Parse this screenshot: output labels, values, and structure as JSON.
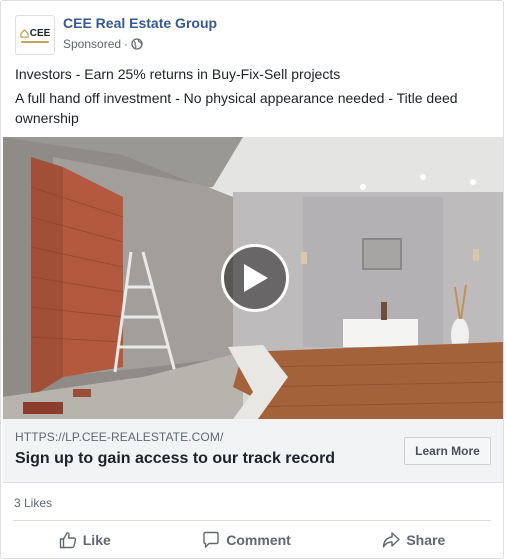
{
  "post": {
    "page_name": "CEE Real Estate Group",
    "sponsored_label": "Sponsored",
    "separator": "·",
    "privacy_icon": "globe-icon",
    "logo_text": "CEE",
    "text_line1": "Investors - Earn 25% returns in Buy-Fix-Sell projects",
    "text_line2": "A full hand off investment - No physical appearance needed - Title deed ownership"
  },
  "media": {
    "type": "video",
    "play_icon": "play-icon"
  },
  "link": {
    "url": "HTTPS://LP.CEE-REALESTATE.COM/",
    "headline": "Sign up to gain access to our track record",
    "cta_label": "Learn More"
  },
  "engagement": {
    "likes": "3 Likes"
  },
  "actions": [
    {
      "label": "Like",
      "icon": "thumbs-up-icon"
    },
    {
      "label": "Comment",
      "icon": "comment-icon"
    },
    {
      "label": "Share",
      "icon": "share-icon"
    }
  ],
  "colors": {
    "page_name": "#365899",
    "muted_text": "#606770",
    "link_bg": "#f2f3f5"
  }
}
